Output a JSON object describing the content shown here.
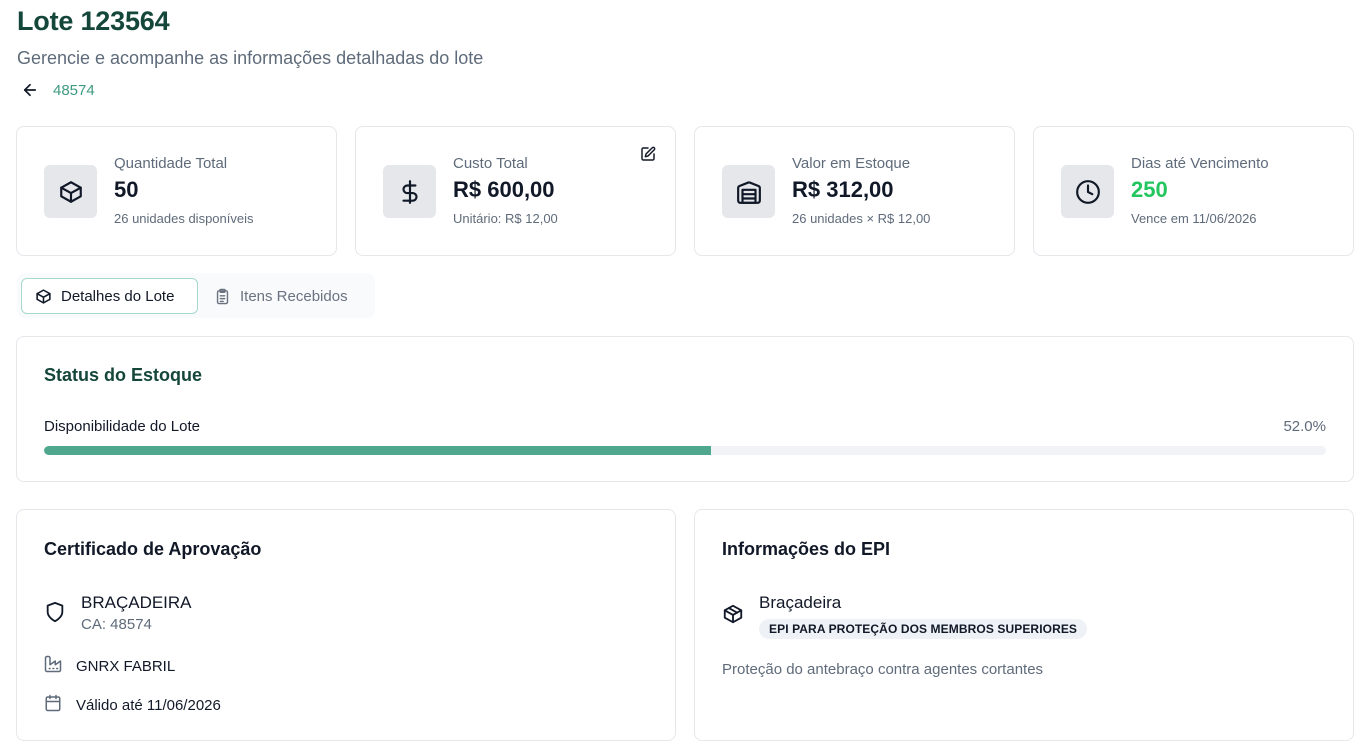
{
  "header": {
    "title": "Lote 123564",
    "subtitle": "Gerencie e acompanhe as informações detalhadas do lote",
    "back_link": "48574"
  },
  "stats": [
    {
      "label": "Quantidade Total",
      "value": "50",
      "sub": "26 unidades disponíveis",
      "icon": "package-icon"
    },
    {
      "label": "Custo Total",
      "value": "R$ 600,00",
      "sub": "Unitário: R$ 12,00",
      "icon": "dollar-icon"
    },
    {
      "label": "Valor em Estoque",
      "value": "R$ 312,00",
      "sub": "26 unidades × R$ 12,00",
      "icon": "warehouse-icon"
    },
    {
      "label": "Dias até Vencimento",
      "value": "250",
      "sub": "Vence em 11/06/2026",
      "icon": "clock-icon"
    }
  ],
  "tabs": [
    {
      "label": "Detalhes do Lote",
      "active": true
    },
    {
      "label": "Itens Recebidos",
      "active": false
    }
  ],
  "status": {
    "title": "Status do Estoque",
    "availability_label": "Disponibilidade do Lote",
    "availability_percent_text": "52.0%",
    "availability_fraction": 0.52
  },
  "certificate": {
    "title": "Certificado de Aprovação",
    "name": "BRAÇADEIRA",
    "ca": "CA: 48574",
    "manufacturer": "GNRX FABRIL",
    "valid_until": "Válido até 11/06/2026"
  },
  "epi": {
    "title": "Informações do EPI",
    "name": "Braçadeira",
    "category": "EPI PARA PROTEÇÃO DOS MEMBROS SUPERIORES",
    "description": "Proteção do antebraço contra agentes cortantes"
  },
  "colors": {
    "title_green": "#14463a",
    "accent": "#4fa88e",
    "positive": "#22c55e"
  }
}
